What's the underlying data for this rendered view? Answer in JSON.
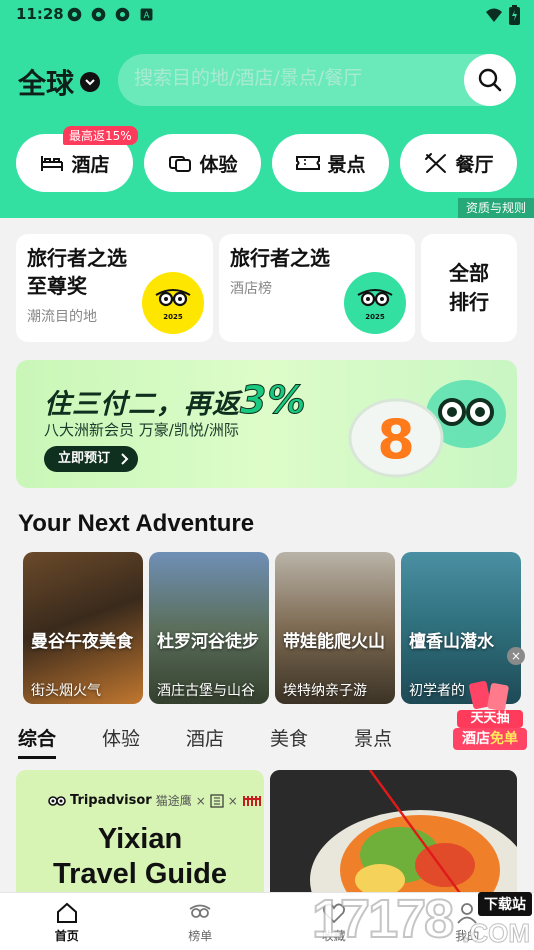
{
  "status_bar": {
    "time": "11:28"
  },
  "header": {
    "region": "全球",
    "search_placeholder": "搜索目的地/酒店/景点/餐厅",
    "categories": [
      {
        "label": "酒店",
        "icon": "bed-icon",
        "badge": "最高返15%"
      },
      {
        "label": "体验",
        "icon": "ticket-icon"
      },
      {
        "label": "景点",
        "icon": "attraction-ticket-icon"
      },
      {
        "label": "餐厅",
        "icon": "utensils-icon"
      }
    ],
    "rules_link": "资质与规则"
  },
  "awards": [
    {
      "title": "旅行者之选至尊奖",
      "title_line1": "旅行者之选",
      "title_line2": "至尊奖",
      "subtitle": "潮流目的地",
      "medal_color": "#ffe600",
      "year": "2025"
    },
    {
      "title": "旅行者之选",
      "subtitle": "酒店榜",
      "medal_color": "#34e0a1",
      "year": "2025"
    },
    {
      "title_line1": "全部",
      "title_line2": "排行"
    }
  ],
  "promo": {
    "title": "住三付二，再返",
    "title_pct": "3%",
    "desc": "八大洲新会员 万豪/凯悦/洲际",
    "button": "立即预订"
  },
  "adventure": {
    "title": "Your Next Adventure",
    "items": [
      {
        "name": "曼谷午夜美食",
        "desc": "街头烟火气"
      },
      {
        "name": "杜罗河谷徒步",
        "desc": "酒庄古堡与山谷"
      },
      {
        "name": "带娃能爬火山",
        "desc": "埃特纳亲子游"
      },
      {
        "name": "檀香山潜水",
        "desc": "初学者的"
      }
    ],
    "close": "×"
  },
  "tabs": [
    "综合",
    "体验",
    "酒店",
    "美食",
    "景点"
  ],
  "float_promo": {
    "line1": "天天抽",
    "line2a": "酒店",
    "line2b": "免单"
  },
  "feed": {
    "brand": "Tripadvisor",
    "brand_partner": "猫途鹰",
    "guide_line1": "Yixian",
    "guide_line2": "Travel Guide"
  },
  "bottom_nav": [
    {
      "label": "首页",
      "icon": "home-icon",
      "active": true
    },
    {
      "label": "榜单",
      "icon": "award-icon",
      "active": false
    },
    {
      "label": "收藏",
      "icon": "heart-icon",
      "active": false
    },
    {
      "label": "我的",
      "icon": "profile-icon",
      "active": false
    }
  ],
  "watermark": {
    "number": "17178",
    "tag": "下载站",
    "domain": ".COM"
  }
}
